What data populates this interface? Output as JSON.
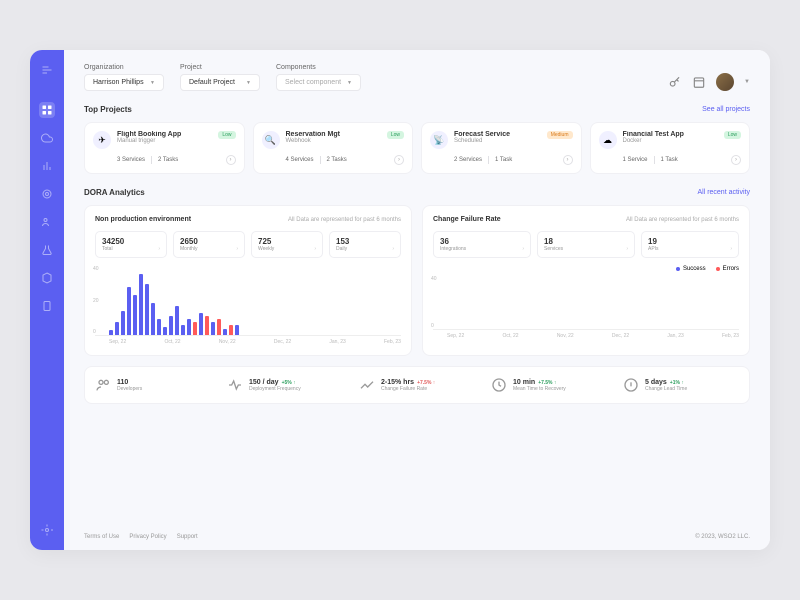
{
  "header": {
    "org_label": "Organization",
    "org_value": "Harrison Phillips",
    "project_label": "Project",
    "project_value": "Default Project",
    "comp_label": "Components",
    "comp_placeholder": "Select component"
  },
  "sections": {
    "top_projects": "Top Projects",
    "see_all": "See all projects",
    "dora": "DORA Analytics",
    "all_recent": "All recent activity"
  },
  "projects": [
    {
      "name": "Flight Booking App",
      "sub": "Manual trigger",
      "badge": "Low",
      "badge_class": "badge-low",
      "services": "3 Services",
      "tasks": "2 Tasks",
      "icon": "✈"
    },
    {
      "name": "Reservation Mgt",
      "sub": "Webhook",
      "badge": "Low",
      "badge_class": "badge-low",
      "services": "4 Services",
      "tasks": "2 Tasks",
      "icon": "🔍"
    },
    {
      "name": "Forecast Service",
      "sub": "Scheduled",
      "badge": "Medium",
      "badge_class": "badge-med",
      "services": "2 Services",
      "tasks": "1 Task",
      "icon": "📡"
    },
    {
      "name": "Financial Test App",
      "sub": "Docker",
      "badge": "Low",
      "badge_class": "badge-low",
      "services": "1 Service",
      "tasks": "1 Task",
      "icon": "☁"
    }
  ],
  "panel1": {
    "title": "Non production environment",
    "sub": "All Data are represented for past 6 months",
    "stats": [
      {
        "val": "34250",
        "lbl": "Total"
      },
      {
        "val": "2650",
        "lbl": "Monthly"
      },
      {
        "val": "725",
        "lbl": "Weekly"
      },
      {
        "val": "153",
        "lbl": "Daily"
      }
    ]
  },
  "panel2": {
    "title": "Change Failure Rate",
    "sub": "All Data are represented for past 6 months",
    "stats": [
      {
        "val": "36",
        "lbl": "Integrations"
      },
      {
        "val": "18",
        "lbl": "Services"
      },
      {
        "val": "19",
        "lbl": "APIs"
      }
    ],
    "legend": {
      "success": "Success",
      "errors": "Errors"
    }
  },
  "chart_data": {
    "type": "bar",
    "x_labels": [
      "Sep, 22",
      "Oct, 22",
      "Nov, 22",
      "Dec, 22",
      "Jan, 23",
      "Feb, 23"
    ],
    "y_labels": [
      "40",
      "20",
      "0"
    ],
    "series": [
      {
        "name": "blue",
        "values": [
          3,
          8,
          15,
          30,
          25,
          38,
          32,
          20,
          10,
          5,
          12,
          18,
          6,
          10,
          14,
          8,
          4,
          6
        ]
      },
      {
        "name": "red",
        "values": [
          0,
          0,
          0,
          0,
          0,
          0,
          0,
          0,
          0,
          0,
          0,
          0,
          0,
          8,
          12,
          10,
          6,
          0
        ]
      }
    ]
  },
  "chart2_y": [
    "40",
    "0"
  ],
  "metrics": [
    {
      "val": "110",
      "lbl": "Developers",
      "change": "",
      "dir": ""
    },
    {
      "val": "150 / day",
      "lbl": "Deployment Frequency",
      "change": "+5% ↑",
      "dir": "up"
    },
    {
      "val": "2-15% hrs",
      "lbl": "Change Failure Rate",
      "change": "+7.5% ↑",
      "dir": "down"
    },
    {
      "val": "10 min",
      "lbl": "Mean Time to Recovery",
      "change": "+7.5% ↑",
      "dir": "up"
    },
    {
      "val": "5 days",
      "lbl": "Change Lead Time",
      "change": "+1% ↑",
      "dir": "up"
    }
  ],
  "footer": {
    "terms": "Terms of Use",
    "privacy": "Privacy Policy",
    "support": "Support",
    "copy": "© 2023, WSO2 LLC."
  }
}
